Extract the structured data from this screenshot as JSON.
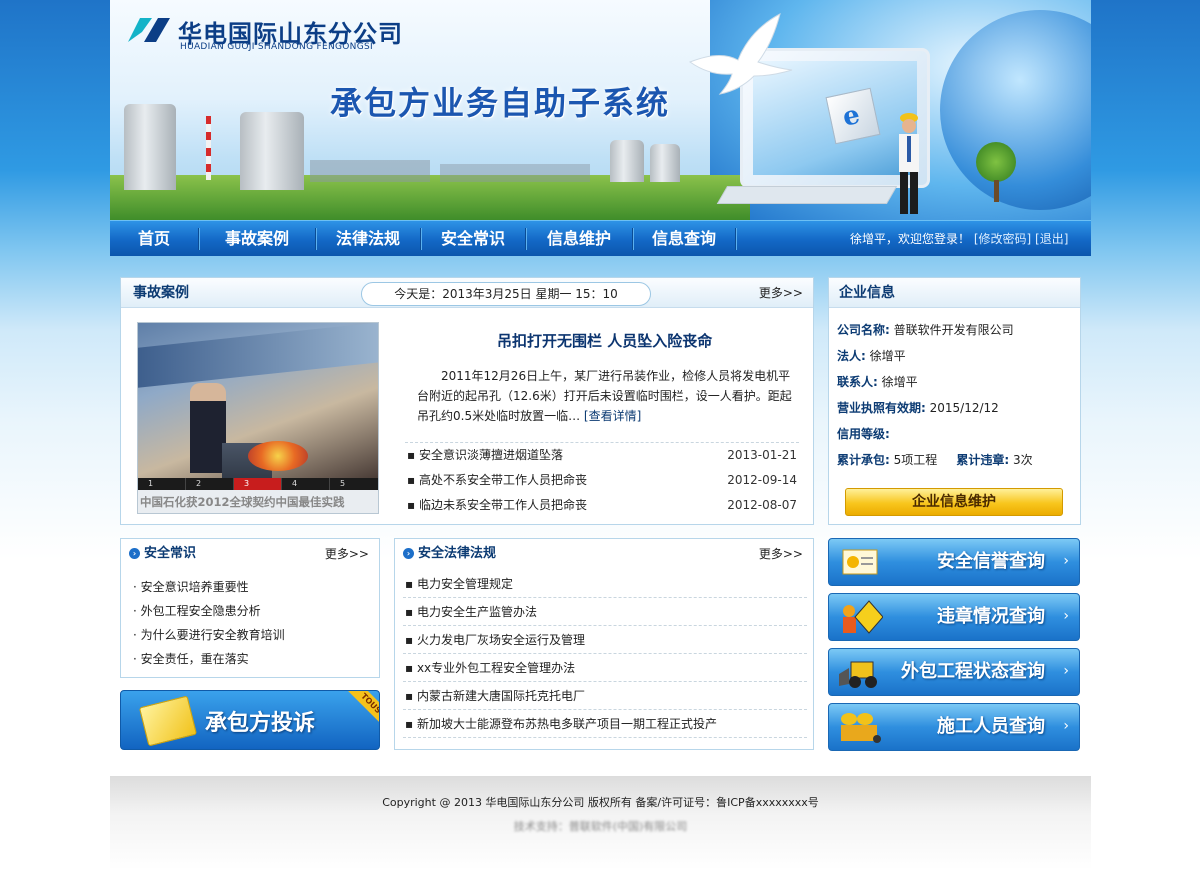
{
  "header": {
    "logo_cn": "华电国际山东分公司",
    "logo_en": "HUADIAN GUOJI SHANDONG FENGONGSI",
    "system_title": "承包方业务自助子系统"
  },
  "nav": {
    "items": [
      "首页",
      "事故案例",
      "法律法规",
      "安全常识",
      "信息维护",
      "信息查询"
    ],
    "welcome": "徐增平，欢迎您登录！",
    "change_password": "[修改密码]",
    "logout": "[退出]"
  },
  "accidents": {
    "title": "事故案例",
    "date_label": "今天是：2013年3月25日  星期一   15：10",
    "more": "更多>>",
    "photo_tabs": [
      "1",
      "2",
      "3",
      "4",
      "5"
    ],
    "photo_active_tab": 3,
    "photo_caption": "中国石化获2012全球契约中国最佳实践",
    "headline": "吊扣打开无围栏 人员坠入险丧命",
    "summary": "2011年12月26日上午，某厂进行吊装作业，检修人员将发电机平台附近的起吊孔（12.6米）打开后未设置临时围栏，设一人看护。距起吊孔约0.5米处临时放置一临…",
    "detail_link": "[查看详情]",
    "list": [
      {
        "title": "安全意识淡薄擅进烟道坠落",
        "date": "2013-01-21"
      },
      {
        "title": "高处不系安全带工作人员把命丧",
        "date": "2012-09-14"
      },
      {
        "title": "临边未系安全带工作人员把命丧",
        "date": "2012-08-07"
      }
    ]
  },
  "company": {
    "title": "企业信息",
    "name_label": "公司名称:",
    "name": "普联软件开发有限公司",
    "legal_label": "法人:",
    "legal": "徐增平",
    "contact_label": "联系人:",
    "contact": "徐增平",
    "license_label": "营业执照有效期:",
    "license": "2015/12/12",
    "credit_label": "信用等级:",
    "total_contract_label": "累计承包:",
    "total_contract": "5项工程",
    "total_violation_label": "累计违章:",
    "total_violation": "3次",
    "maintain_button": "企业信息维护"
  },
  "safety_knowledge": {
    "title": "安全常识",
    "more": "更多>>",
    "items": [
      "安全意识培养重要性",
      "外包工程安全隐患分析",
      "为什么要进行安全教育培训",
      "安全责任，重在落实"
    ]
  },
  "laws": {
    "title": "安全法律法规",
    "more": "更多>>",
    "items": [
      "电力安全管理规定",
      "电力安全生产监管办法",
      "火力发电厂灰场安全运行及管理",
      "xx专业外包工程安全管理办法",
      "内蒙古新建大唐国际托克托电厂",
      "新加坡大士能源登布苏热电多联产项目一期工程正式投产"
    ]
  },
  "complaint": {
    "label": "承包方投诉",
    "tag": "TOUSU"
  },
  "queries": {
    "credit": "安全信誉查询",
    "violation": "违章情况查询",
    "project": "外包工程状态查询",
    "staff": "施工人员查询"
  },
  "footer": {
    "copyright": "Copyright @ 2013 华电国际山东分公司 版权所有  备案/许可证号：鲁ICP备xxxxxxxx号",
    "support": "技术支持：普联软件(中国)有限公司"
  }
}
